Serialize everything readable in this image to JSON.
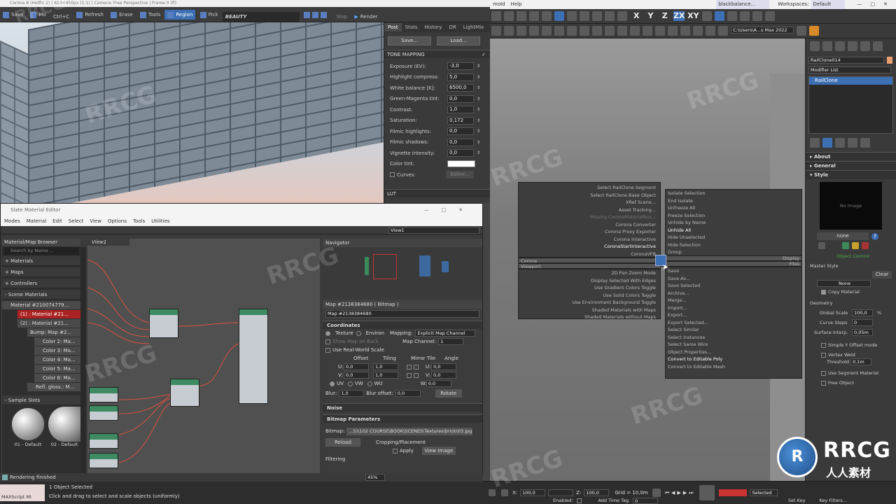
{
  "render_window": {
    "title": "Corona 8 (Hotfix 2) | 814×450px (1:1) | Camera: Free Perspective | Frame 0 (fl)",
    "toolbar": [
      "Save",
      "Mo",
      "Ctrl+C",
      "Refresh",
      "Erase",
      "Tools",
      "Region",
      "Pick"
    ],
    "beauty_label": "BEAUTY",
    "stop_label": "Stop",
    "render_label": "Render",
    "tabs": [
      "Post",
      "Stats",
      "History",
      "DR",
      "LightMix"
    ],
    "save_btn": "Save...",
    "load_btn": "Load...",
    "tone_mapping_label": "TONE MAPPING",
    "params": [
      {
        "label": "Exposure (EV):",
        "value": "-3,0"
      },
      {
        "label": "Highlight compress:",
        "value": "5,0"
      },
      {
        "label": "White balance [K]:",
        "value": "6500,0"
      },
      {
        "label": "Green-Magenta tint:",
        "value": "0,0"
      },
      {
        "label": "Contrast:",
        "value": "1,0"
      },
      {
        "label": "Saturation:",
        "value": "0,172"
      },
      {
        "label": "Filmic highlights:",
        "value": "0,0"
      },
      {
        "label": "Filmic shadows:",
        "value": "0,0"
      },
      {
        "label": "Vignette intensity:",
        "value": "0,0"
      }
    ],
    "color_tint_label": "Color tint:",
    "curves_label": "Curves:",
    "editor_btn": "Editor...",
    "lut_label": "LUT"
  },
  "material_editor": {
    "title": "Slate Material Editor",
    "menu": [
      "Modes",
      "Material",
      "Edit",
      "Select",
      "View",
      "Options",
      "Tools",
      "Utilities"
    ],
    "view_dropdown": "View1",
    "browser_title": "Material/Map Browser",
    "search_placeholder": "Search by Name ...",
    "categories": [
      "+ Materials",
      "+ Maps",
      "+ Controllers",
      "- Scene Materials"
    ],
    "tree": [
      "Material #210074779...",
      "(1) : Material #21...",
      "(2) : Material #21...",
      "Bump: Map #2...",
      "Color 2: Ma...",
      "Color 3: Ma...",
      "Color 4: Ma...",
      "Color 5: Ma...",
      "Color 6: Ma...",
      "Refl. gloss.: M..."
    ],
    "sample_slots_label": "- Sample Slots",
    "samples": [
      "01 - Default",
      "02 - Default"
    ],
    "view_tab": "View1",
    "navigator_title": "Navigator",
    "map_header": "Map #2138384680  ( Bitmap )",
    "map_name": "Map #2138384680",
    "coordinates_label": "Coordinates",
    "texture_label": "Texture",
    "environ_label": "Environ",
    "mapping_label": "Mapping:",
    "mapping_value": "Explicit Map Channel",
    "show_map_label": "Show Map on Back",
    "map_channel_label": "Map Channel:",
    "map_channel_value": "1",
    "real_world_label": "Use Real-World Scale",
    "col_headers": [
      "Offset",
      "Tiling",
      "Mirror Tile",
      "Angle"
    ],
    "u_row": {
      "label": "U:",
      "offset": "0,0",
      "tiling": "1,0",
      "angle": "0,0"
    },
    "v_row": {
      "label": "V:",
      "offset": "0,0",
      "tiling": "1,0",
      "angle": "0,0"
    },
    "w_angle": "0,0",
    "uv_options": [
      "UV",
      "VW",
      "WU"
    ],
    "blur_label": "Blur:",
    "blur_value": "1,0",
    "blur_offset_label": "Blur offset:",
    "blur_offset_value": "0,0",
    "rotate_btn": "Rotate",
    "noise_label": "Noise",
    "bitmap_params_label": "Bitmap Parameters",
    "bitmap_label": "Bitmap:",
    "bitmap_path": "...5)\\102 COURSE\\BOOK\\SCENES\\Textures\\brick\\03.jpg",
    "reload_btn": "Reload",
    "cropping_label": "Cropping/Placement",
    "apply_label": "Apply",
    "view_image_btn": "View Image",
    "filtering_label": "Filtering",
    "rendering_finished": "Rendering finished",
    "zoom": "45%"
  },
  "max": {
    "menu": [
      "mold",
      "Help"
    ],
    "user": "blackbalance...",
    "workspaces_label": "Workspaces:",
    "workspace_value": "Default",
    "axis": [
      "X",
      "Y",
      "Z",
      "ZX",
      "XY"
    ],
    "path_field": "C:\\Users\\A...s Max 2022",
    "quad_left_top": [
      "Select RailClone Segment",
      "Select RailClone Base Object",
      "XRef Scene...",
      "Asset Tracking...",
      "Missing CoronaMaterialBox...",
      "Corona Converter",
      "Corona Proxy Exporter",
      "Corona Interactive",
      "CoronaStartInteractive",
      "CoronaVFB"
    ],
    "quad_left_header": "Corona",
    "quad_left_bottom_header": "Viewport",
    "quad_left_bottom": [
      "2D Pan Zoom Mode",
      "Display Selected With Edges",
      "Use Gradient Colors Toggle",
      "Use Solid Colors Toggle",
      "Use Environment Background Toggle",
      "Shaded Materials with Maps",
      "Shaded Materials without Maps"
    ],
    "quad_right_top": [
      "Isolate Selection",
      "End Isolate",
      "Unfreeze All",
      "Freeze Selection",
      "Unhide by Name",
      "Unhide All",
      "Hide Unselected",
      "Hide Selection",
      "Group"
    ],
    "quad_right_header_display": "Display",
    "quad_right_header_files": "Files",
    "quad_right_bottom": [
      "Save",
      "Save As...",
      "Save Selected",
      "Archive...",
      "Merge...",
      "Import...",
      "Export...",
      "Export Selected...",
      "Select Similar",
      "Select Instances",
      "Select Same Wire",
      "Object Properties...",
      "Convert to Editable Poly",
      "Convert to Editable Mesh"
    ],
    "object_name": "RailClone014",
    "modifier_list": "Modifier List",
    "modifier_item": "RailClone",
    "rollouts": [
      "About",
      "General",
      "Style"
    ],
    "no_image": "No Image",
    "none_btn": "none",
    "object_control": "Object Control",
    "master_style": "Master Style",
    "clear_btn": "Clear",
    "none_field": "None",
    "copy_material": "Copy Material",
    "geometry": "Geometry",
    "global_scale_label": "Global Scale",
    "global_scale_value": "100,0",
    "global_scale_unit": "%",
    "curve_steps_label": "Curve Steps",
    "curve_steps_value": "0",
    "surface_interp_label": "Surface Interp.",
    "surface_interp_value": "0,05m",
    "simple_y_offset": "Simple Y Offset mode",
    "vertex_weld": "Vertex Weld",
    "threshold_label": "Threshold",
    "threshold_value": "0,1m",
    "use_segment_material": "Use Segment Material",
    "free_object": "Free Object"
  },
  "status": {
    "script_label": "MAXScript Mi",
    "selection": "1 Object Selected",
    "hint": "Click and drag to select and scale objects (uniformly)",
    "x_label": "X:",
    "x_value": "100,0",
    "z_label": "Z:",
    "z_value": "100,0",
    "grid": "Grid = 10,0m",
    "enabled": "Enabled:",
    "add_time_tag": "Add Time Tag",
    "frame": "0",
    "selected_dropdown": "Selected",
    "set_key": "Set Key",
    "key_filters": "Key Filters..."
  },
  "watermark": "RRCG",
  "logo_text": "RRCG",
  "logo_sub": "人人素材",
  "colors": {
    "accent": "#3d6fb4",
    "node_green": "#3e8a62",
    "wire": "#d8523e"
  }
}
